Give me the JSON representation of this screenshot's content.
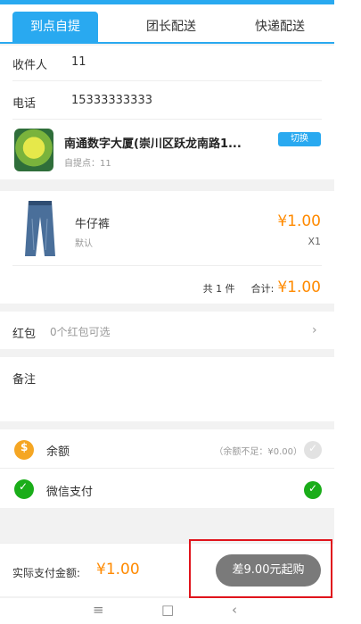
{
  "tabs": [
    {
      "label": "到点自提",
      "active": true
    },
    {
      "label": "团长配送",
      "active": false
    },
    {
      "label": "快递配送",
      "active": false
    }
  ],
  "recipient": {
    "label": "收件人",
    "value": "11"
  },
  "phone": {
    "label": "电话",
    "value": "15333333333"
  },
  "store": {
    "name": "南通数字大厦(崇川区跃龙南路1...",
    "sub": "自提点：11",
    "switch_label": "切换"
  },
  "product": {
    "name": "牛仔裤",
    "spec": "默认",
    "price": "¥1.00",
    "qty": "X1"
  },
  "summary": {
    "count_label": "共 1 件",
    "total_label": "合计:",
    "total_value": "¥1.00"
  },
  "hongbao": {
    "label": "红包",
    "value": "0个红包可选"
  },
  "note": {
    "label": "备注"
  },
  "payment": {
    "balance": {
      "label": "余额",
      "note": "（余额不足：¥0.00）"
    },
    "wechat": {
      "label": "微信支付"
    }
  },
  "footer": {
    "pay_total_label": "实际支付金额:",
    "pay_total_value": "¥1.00",
    "submit_label": "差9.00元起购"
  },
  "colors": {
    "accent": "#29a9f0",
    "price": "#ff8a00",
    "wechat": "#1aad19",
    "highlight": "#e0141c"
  }
}
